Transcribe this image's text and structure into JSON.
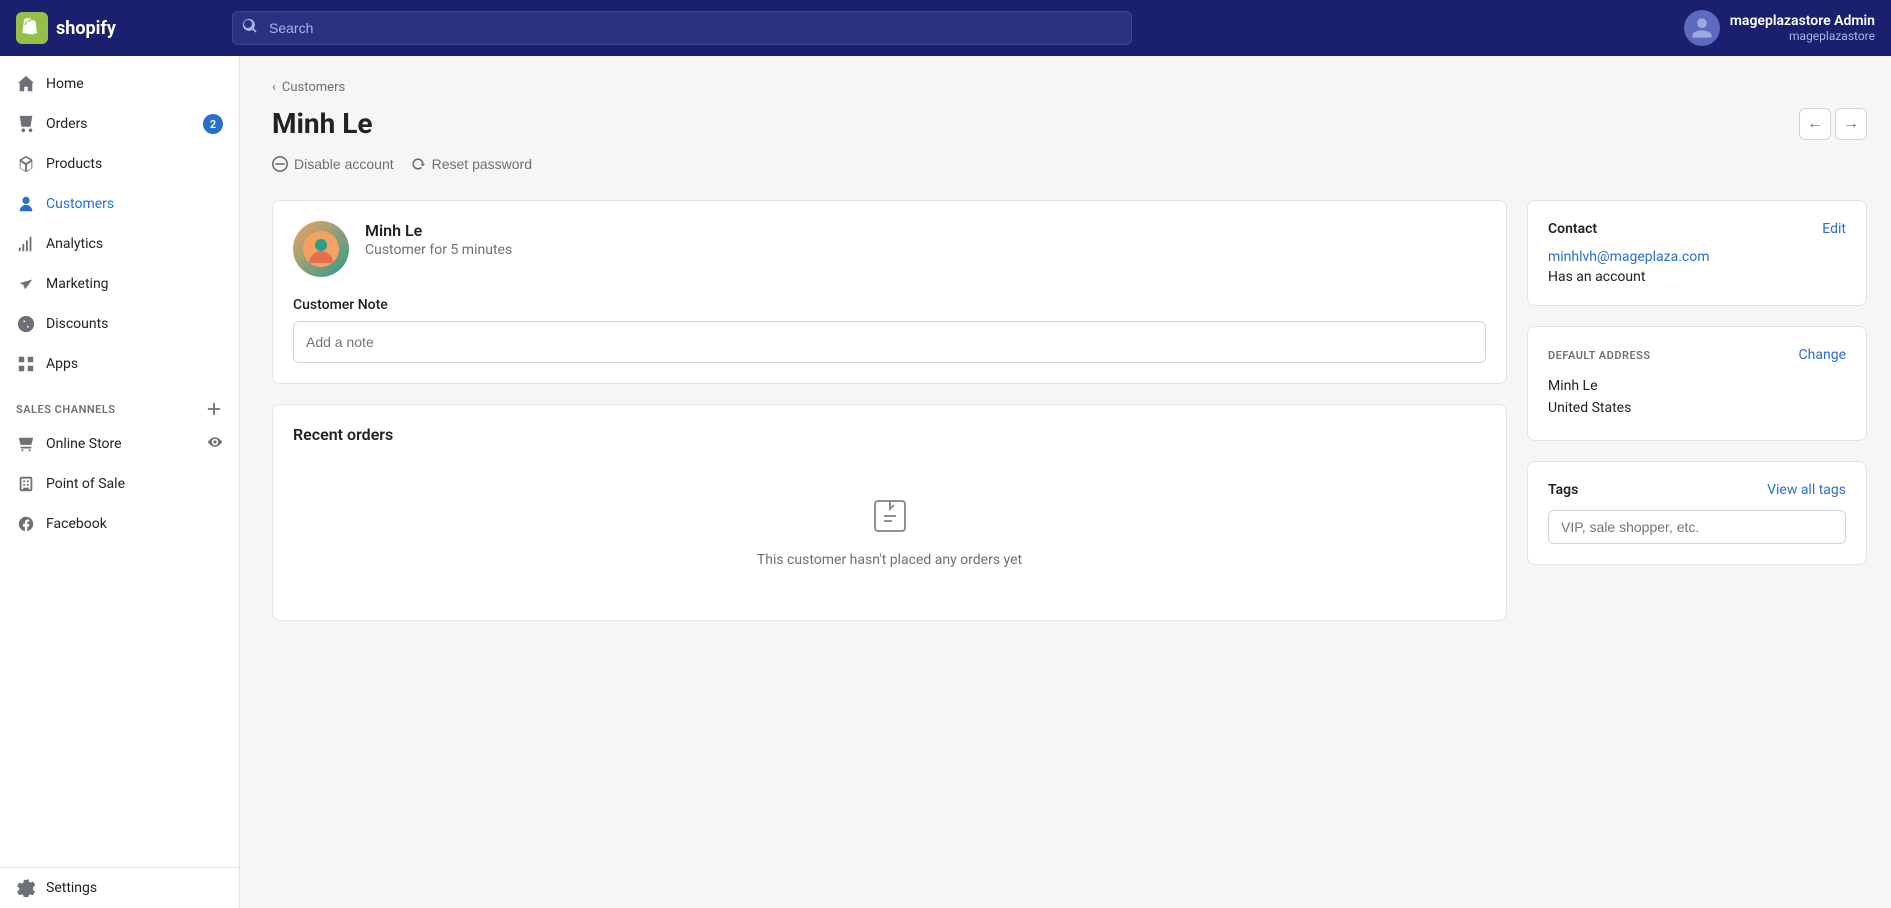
{
  "topnav": {
    "logo_text": "shopify",
    "search_placeholder": "Search",
    "user_name": "mageplazastore Admin",
    "user_store": "mageplazastore"
  },
  "sidebar": {
    "nav_items": [
      {
        "id": "home",
        "label": "Home",
        "icon": "home"
      },
      {
        "id": "orders",
        "label": "Orders",
        "icon": "orders",
        "badge": "2"
      },
      {
        "id": "products",
        "label": "Products",
        "icon": "products"
      },
      {
        "id": "customers",
        "label": "Customers",
        "icon": "customers",
        "active": true
      },
      {
        "id": "analytics",
        "label": "Analytics",
        "icon": "analytics"
      },
      {
        "id": "marketing",
        "label": "Marketing",
        "icon": "marketing"
      },
      {
        "id": "discounts",
        "label": "Discounts",
        "icon": "discounts"
      },
      {
        "id": "apps",
        "label": "Apps",
        "icon": "apps"
      }
    ],
    "sales_channels_label": "SALES CHANNELS",
    "sales_channels": [
      {
        "id": "online-store",
        "label": "Online Store",
        "icon": "store",
        "has_eye": true
      },
      {
        "id": "point-of-sale",
        "label": "Point of Sale",
        "icon": "pos"
      },
      {
        "id": "facebook",
        "label": "Facebook",
        "icon": "facebook"
      }
    ],
    "settings_label": "Settings"
  },
  "breadcrumb": {
    "text": "Customers",
    "back_arrow": "‹"
  },
  "page": {
    "title": "Minh Le",
    "disable_account_label": "Disable account",
    "reset_password_label": "Reset password"
  },
  "customer_card": {
    "name": "Minh Le",
    "duration": "Customer for 5 minutes",
    "note_label": "Customer Note",
    "note_placeholder": "Add a note"
  },
  "recent_orders": {
    "title": "Recent orders",
    "empty_message": "This customer hasn't placed any orders yet"
  },
  "contact": {
    "title": "Contact",
    "edit_label": "Edit",
    "email": "minhlvh@mageplaza.com",
    "account_status": "Has an account"
  },
  "default_address": {
    "label": "DEFAULT ADDRESS",
    "change_label": "Change",
    "name": "Minh Le",
    "country": "United States"
  },
  "tags": {
    "title": "Tags",
    "view_all_label": "View all tags",
    "input_placeholder": "VIP, sale shopper, etc."
  }
}
